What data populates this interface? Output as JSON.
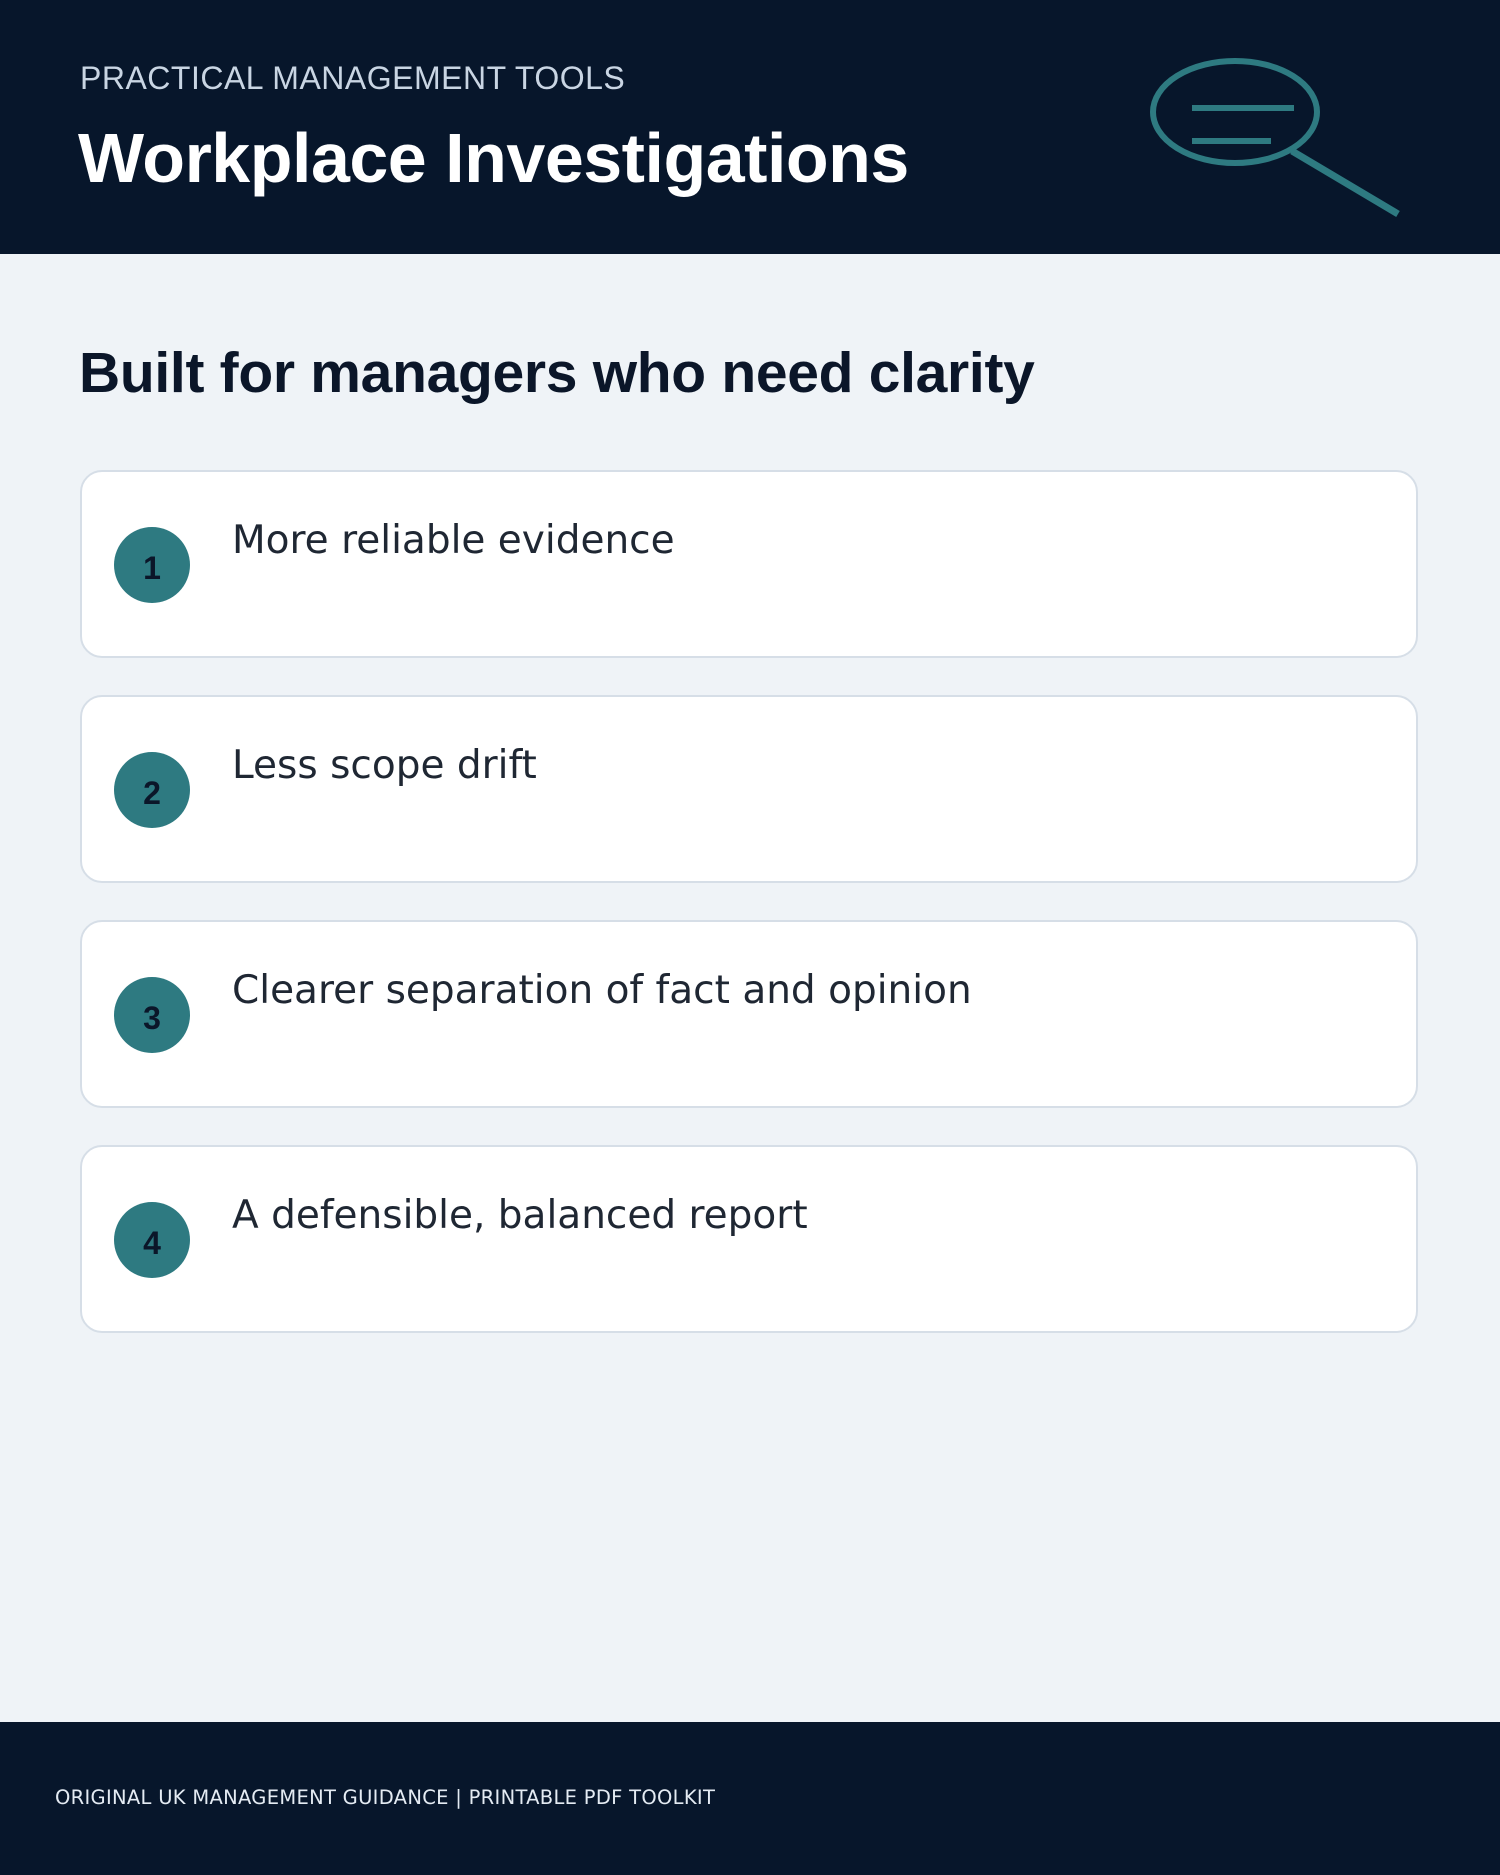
{
  "header": {
    "eyebrow": "PRACTICAL MANAGEMENT TOOLS",
    "title": "Workplace Investigations",
    "icon": "magnifying-glass-icon"
  },
  "main": {
    "heading": "Built for managers who need clarity",
    "items": [
      {
        "number": "1",
        "text": "More reliable evidence"
      },
      {
        "number": "2",
        "text": "Less scope drift"
      },
      {
        "number": "3",
        "text": "Clearer separation of fact and opinion"
      },
      {
        "number": "4",
        "text": "A defensible, balanced report"
      }
    ]
  },
  "footer": {
    "text": "ORIGINAL UK MANAGEMENT GUIDANCE | PRINTABLE PDF TOOLKIT"
  },
  "colors": {
    "navy": "#07162b",
    "teal": "#2e7a81",
    "page_background": "#eff3f7"
  }
}
